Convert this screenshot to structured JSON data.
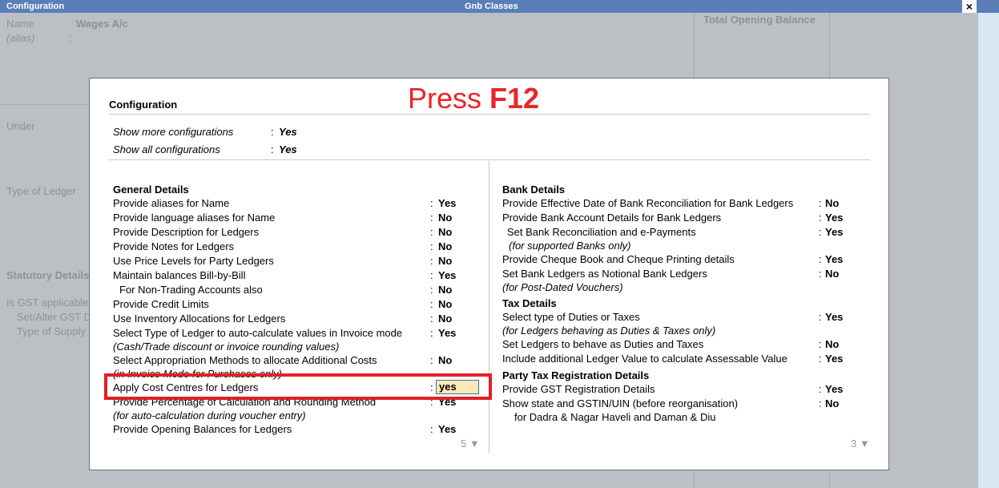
{
  "window": {
    "left_title": "Configuration",
    "center_title": "Gnb Classes",
    "close_label": "×"
  },
  "background_form": {
    "name_label": "Name",
    "name_value": "Wages A/c",
    "alias_label": "(alias)",
    "alias_colon": ":",
    "total_opening_balance": "Total Opening Balance",
    "under_label": "Under",
    "type_of_ledger_label": "Type of Ledger",
    "statutory_details": "Statutory Details",
    "is_gst_applicable": "Is GST applicable",
    "set_alter_gst": "Set/Alter GST D",
    "type_of_supply": "Type of Supply"
  },
  "dialog": {
    "title": "Configuration",
    "press_prefix": "Press ",
    "press_key": "F12",
    "top_options": [
      {
        "label": "Show more configurations",
        "colon": ":",
        "value": "Yes"
      },
      {
        "label": "Show all configurations",
        "colon": ":",
        "value": "Yes"
      }
    ],
    "left_header": "General Details",
    "left_items": [
      {
        "label": "Provide aliases for Name",
        "colon": ":",
        "value": "Yes"
      },
      {
        "label": "Provide language aliases for Name",
        "colon": ":",
        "value": "No"
      },
      {
        "label": "Provide Description for Ledgers",
        "colon": ":",
        "value": "No"
      },
      {
        "label": "Provide Notes for Ledgers",
        "colon": ":",
        "value": "No"
      },
      {
        "label": "Use Price Levels for Party Ledgers",
        "colon": ":",
        "value": "No"
      },
      {
        "label": "Maintain balances Bill-by-Bill",
        "colon": ":",
        "value": "Yes"
      },
      {
        "label": "For Non-Trading Accounts also",
        "colon": ":",
        "value": "No"
      },
      {
        "label": "Provide Credit Limits",
        "colon": ":",
        "value": "No"
      },
      {
        "label": "Use Inventory Allocations for Ledgers",
        "colon": ":",
        "value": "No"
      },
      {
        "label": "Select Type of Ledger to auto-calculate values in Invoice mode",
        "colon": ":",
        "value": "Yes"
      },
      {
        "label": "(Cash/Trade discount or invoice rounding values)"
      },
      {
        "label": "Select Appropriation Methods to allocate Additional Costs",
        "colon": ":",
        "value": "No"
      },
      {
        "label": "(in Invoice Mode for Purchases only)"
      },
      {
        "label": "Apply Cost Centres for Ledgers",
        "colon": ":",
        "value": "yes"
      },
      {
        "label": "Provide Percentage of Calculation and Rounding Method",
        "colon": ":",
        "value": "Yes"
      },
      {
        "label": "(for auto-calculation during voucher entry)"
      },
      {
        "label": "Provide Opening Balances for Ledgers",
        "colon": ":",
        "value": "Yes"
      }
    ],
    "left_pager": "5 ▼",
    "right_sections": {
      "bank_header": "Bank Details",
      "bank_items": [
        {
          "label": "Provide Effective Date of Bank Reconciliation for Bank Ledgers",
          "colon": ":",
          "value": "No"
        },
        {
          "label": "Provide Bank Account Details for Bank Ledgers",
          "colon": ":",
          "value": "Yes"
        },
        {
          "label": "Set Bank Reconciliation and e-Payments",
          "colon": ":",
          "value": "Yes"
        },
        {
          "label": "(for supported Banks only)"
        },
        {
          "label": "Provide Cheque Book and Cheque Printing details",
          "colon": ":",
          "value": "Yes"
        },
        {
          "label": "Set Bank Ledgers as Notional Bank Ledgers",
          "colon": ":",
          "value": "No"
        },
        {
          "label": "(for Post-Dated Vouchers)"
        }
      ],
      "tax_header": "Tax Details",
      "tax_items": [
        {
          "label": "Select type of Duties or Taxes",
          "colon": ":",
          "value": "Yes"
        },
        {
          "label": "(for Ledgers behaving as Duties & Taxes only)"
        },
        {
          "label": "Set Ledgers to behave as Duties and Taxes",
          "colon": ":",
          "value": "No"
        },
        {
          "label": "Include additional Ledger Value to calculate Assessable Value",
          "colon": ":",
          "value": "Yes"
        }
      ],
      "party_header": "Party Tax Registration Details",
      "party_items": [
        {
          "label": "Provide GST Registration Details",
          "colon": ":",
          "value": "Yes"
        },
        {
          "label": "Show state and GSTIN/UIN (before reorganisation)",
          "colon": ":",
          "value": "No"
        },
        {
          "label": "for Dadra & Nagar Haveli and Daman & Diu"
        }
      ]
    },
    "right_pager": "3 ▼"
  }
}
